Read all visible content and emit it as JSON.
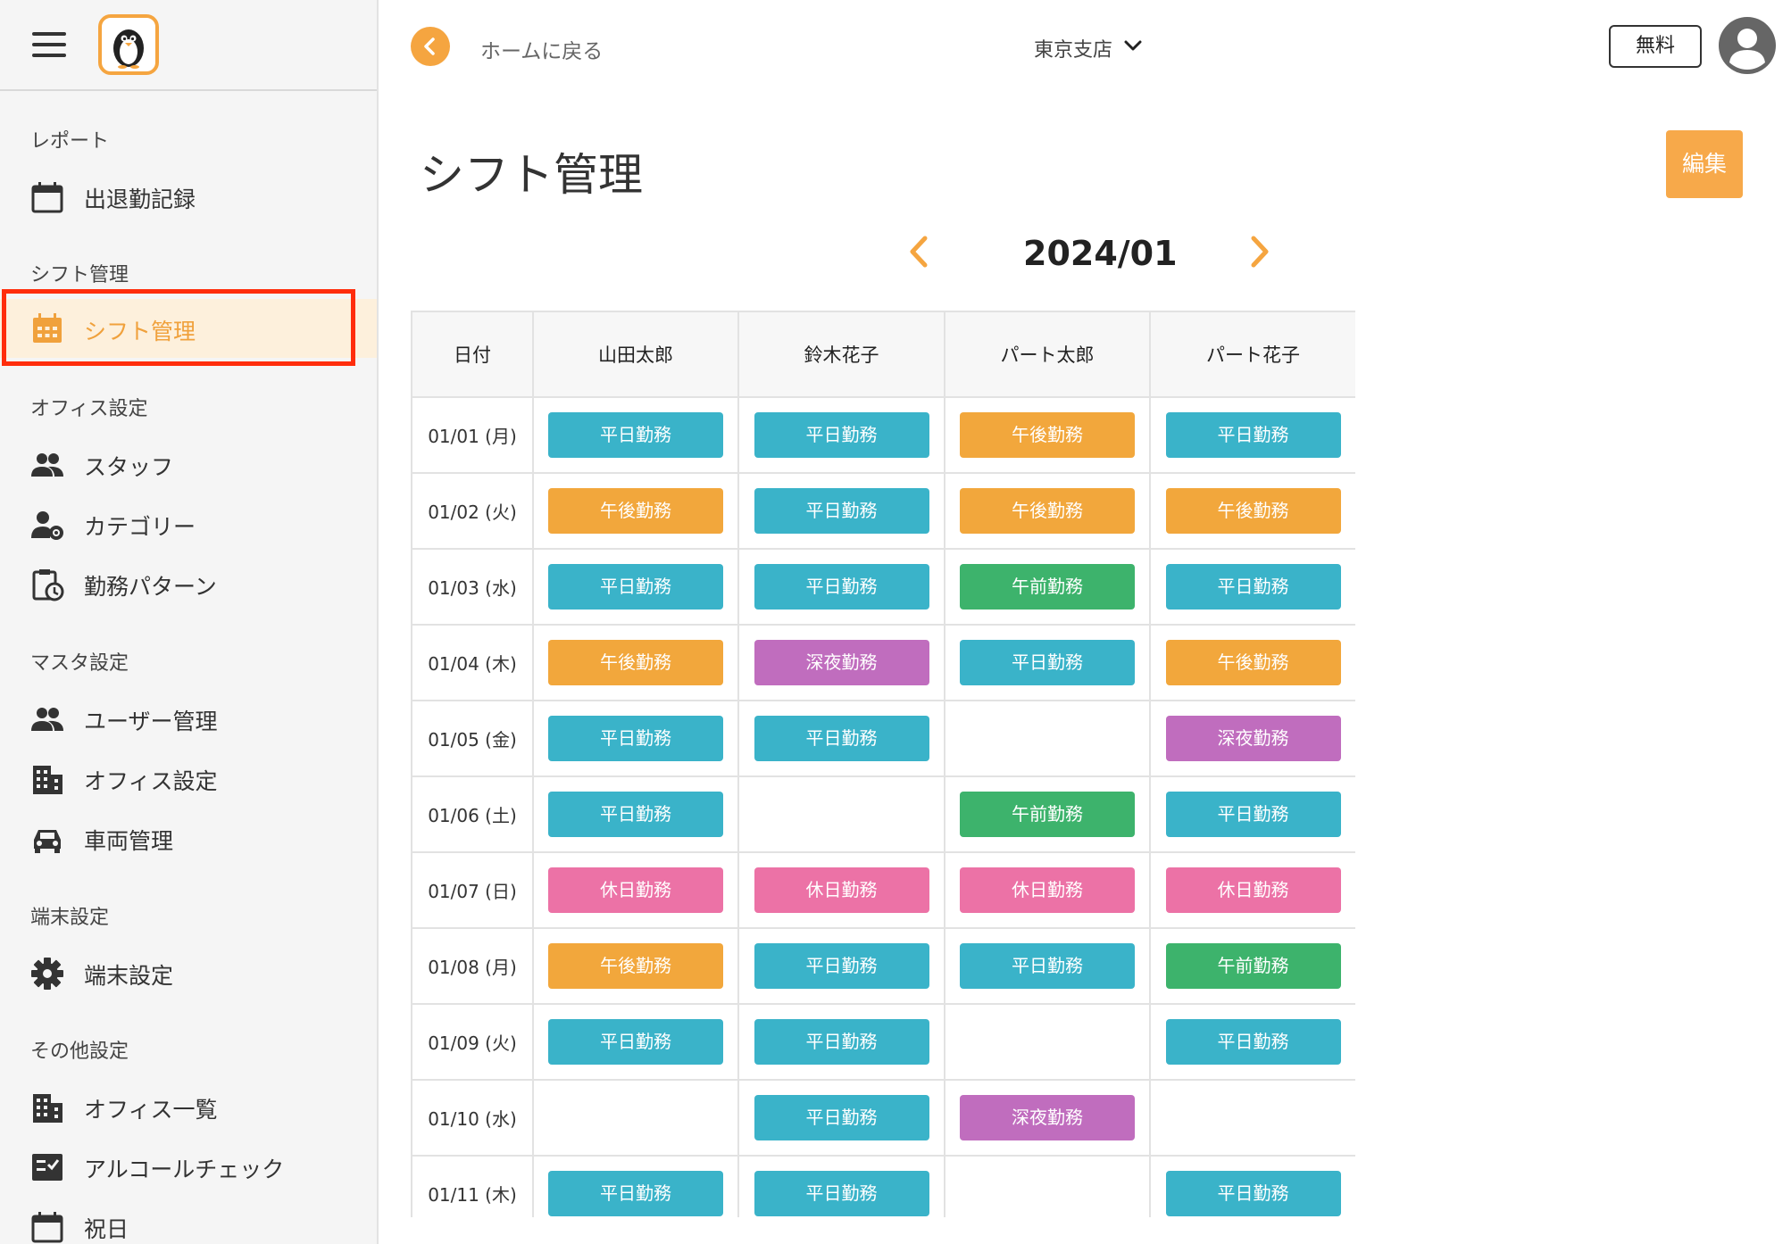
{
  "colors": {
    "accent": "#f5a540",
    "weekday": "#3ab3c9",
    "afternoon": "#f2a73c",
    "morning": "#3db36c",
    "night": "#c06dbe",
    "holiday": "#ec72a6",
    "highlight": "#ff2d0c"
  },
  "sidebar": {
    "sections": [
      {
        "title": "レポート",
        "items": [
          {
            "label": "出退勤記録",
            "icon": "calendar-icon"
          }
        ]
      },
      {
        "title": "シフト管理",
        "items": [
          {
            "label": "シフト管理",
            "icon": "calendar-grid-icon"
          }
        ]
      },
      {
        "title": "オフィス設定",
        "items": [
          {
            "label": "スタッフ",
            "icon": "people-icon"
          },
          {
            "label": "カテゴリー",
            "icon": "person-gear-icon"
          },
          {
            "label": "勤務パターン",
            "icon": "clipboard-clock-icon"
          }
        ]
      },
      {
        "title": "マスタ設定",
        "items": [
          {
            "label": "ユーザー管理",
            "icon": "people-icon"
          },
          {
            "label": "オフィス設定",
            "icon": "building-icon"
          },
          {
            "label": "車両管理",
            "icon": "car-icon"
          }
        ]
      },
      {
        "title": "端末設定",
        "items": [
          {
            "label": "端末設定",
            "icon": "gear-icon"
          }
        ]
      },
      {
        "title": "その他設定",
        "items": [
          {
            "label": "オフィス一覧",
            "icon": "building-list-icon"
          },
          {
            "label": "アルコールチェック",
            "icon": "checklist-icon"
          },
          {
            "label": "祝日",
            "icon": "calendar-icon"
          }
        ]
      }
    ]
  },
  "topbar": {
    "back_label": "ホームに戻る",
    "branch": "東京支店",
    "free_label": "無料"
  },
  "page": {
    "title": "シフト管理",
    "edit_label": "編集",
    "month": "2024/01"
  },
  "table": {
    "headers": [
      "日付",
      "山田太郎",
      "鈴木花子",
      "パート太郎",
      "パート花子"
    ],
    "rows": [
      {
        "date": "01/01 (月)",
        "shifts": [
          "平日勤務",
          "平日勤務",
          "午後勤務",
          "平日勤務"
        ]
      },
      {
        "date": "01/02 (火)",
        "shifts": [
          "午後勤務",
          "平日勤務",
          "午後勤務",
          "午後勤務"
        ]
      },
      {
        "date": "01/03 (水)",
        "shifts": [
          "平日勤務",
          "平日勤務",
          "午前勤務",
          "平日勤務"
        ]
      },
      {
        "date": "01/04 (木)",
        "shifts": [
          "午後勤務",
          "深夜勤務",
          "平日勤務",
          "午後勤務"
        ]
      },
      {
        "date": "01/05 (金)",
        "shifts": [
          "平日勤務",
          "平日勤務",
          "",
          "深夜勤務"
        ]
      },
      {
        "date": "01/06 (土)",
        "shifts": [
          "平日勤務",
          "",
          "午前勤務",
          "平日勤務"
        ]
      },
      {
        "date": "01/07 (日)",
        "shifts": [
          "休日勤務",
          "休日勤務",
          "休日勤務",
          "休日勤務"
        ]
      },
      {
        "date": "01/08 (月)",
        "shifts": [
          "午後勤務",
          "平日勤務",
          "平日勤務",
          "午前勤務"
        ]
      },
      {
        "date": "01/09 (火)",
        "shifts": [
          "平日勤務",
          "平日勤務",
          "",
          "平日勤務"
        ]
      },
      {
        "date": "01/10 (水)",
        "shifts": [
          "",
          "平日勤務",
          "深夜勤務",
          ""
        ]
      },
      {
        "date": "01/11 (木)",
        "shifts": [
          "平日勤務",
          "平日勤務",
          "",
          "平日勤務"
        ]
      }
    ]
  }
}
